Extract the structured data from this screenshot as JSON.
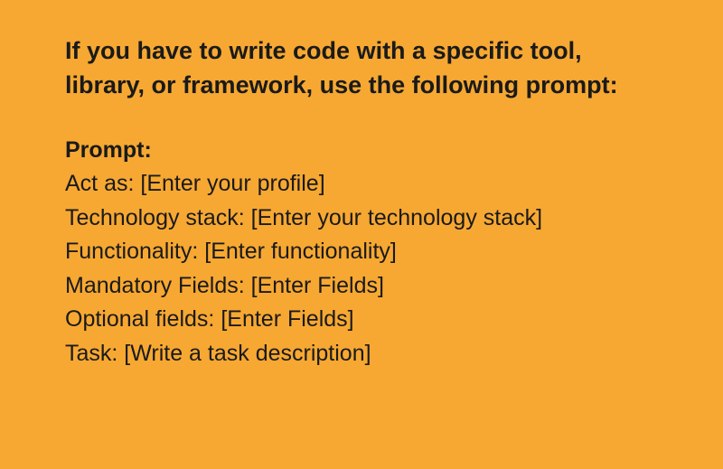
{
  "heading": "If you have to write code with a specific tool, library, or framework, use the following prompt:",
  "prompt_label": "Prompt:",
  "fields": [
    {
      "label": "Act as: ",
      "placeholder": "[Enter your profile]"
    },
    {
      "label": "Technology stack: ",
      "placeholder": "[Enter your technology stack]"
    },
    {
      "label": "Functionality: ",
      "placeholder": "[Enter functionality]"
    },
    {
      "label": "Mandatory Fields: ",
      "placeholder": "[Enter Fields]"
    },
    {
      "label": "Optional fields: ",
      "placeholder": "[Enter Fields]"
    },
    {
      "label": "Task: ",
      "placeholder": "[Write a task description]"
    }
  ]
}
